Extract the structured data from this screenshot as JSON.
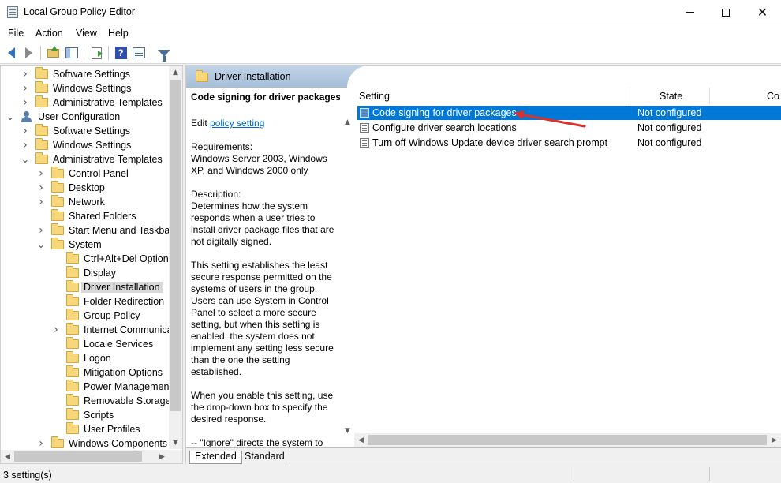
{
  "window": {
    "title": "Local Group Policy Editor",
    "icon": "policy-editor-icon"
  },
  "menu": [
    "File",
    "Action",
    "View",
    "Help"
  ],
  "toolbar": {
    "buttons": [
      "back-icon",
      "forward-icon",
      "up-folder-icon",
      "show-hide-pane-icon",
      "export-list-icon",
      "help-icon",
      "properties-pane-icon",
      "filter-icon"
    ]
  },
  "tree": {
    "items": [
      {
        "label": "Software Settings",
        "depth": 1,
        "expander": "collapsed",
        "icon": "folder-icon"
      },
      {
        "label": "Windows Settings",
        "depth": 1,
        "expander": "collapsed",
        "icon": "folder-icon"
      },
      {
        "label": "Administrative Templates",
        "depth": 1,
        "expander": "collapsed",
        "icon": "folder-icon"
      },
      {
        "label": "User Configuration",
        "depth": 0,
        "expander": "expanded",
        "icon": "user-icon"
      },
      {
        "label": "Software Settings",
        "depth": 1,
        "expander": "collapsed",
        "icon": "folder-icon"
      },
      {
        "label": "Windows Settings",
        "depth": 1,
        "expander": "collapsed",
        "icon": "folder-icon"
      },
      {
        "label": "Administrative Templates",
        "depth": 1,
        "expander": "expanded",
        "icon": "folder-icon"
      },
      {
        "label": "Control Panel",
        "depth": 2,
        "expander": "collapsed",
        "icon": "folder-icon"
      },
      {
        "label": "Desktop",
        "depth": 2,
        "expander": "collapsed",
        "icon": "folder-icon"
      },
      {
        "label": "Network",
        "depth": 2,
        "expander": "collapsed",
        "icon": "folder-icon"
      },
      {
        "label": "Shared Folders",
        "depth": 2,
        "expander": "none",
        "icon": "folder-icon"
      },
      {
        "label": "Start Menu and Taskbar",
        "depth": 2,
        "expander": "collapsed",
        "icon": "folder-icon"
      },
      {
        "label": "System",
        "depth": 2,
        "expander": "expanded",
        "icon": "folder-icon"
      },
      {
        "label": "Ctrl+Alt+Del Options",
        "depth": 3,
        "expander": "none",
        "icon": "folder-icon"
      },
      {
        "label": "Display",
        "depth": 3,
        "expander": "none",
        "icon": "folder-icon"
      },
      {
        "label": "Driver Installation",
        "depth": 3,
        "expander": "none",
        "icon": "folder-icon",
        "selected": true
      },
      {
        "label": "Folder Redirection",
        "depth": 3,
        "expander": "none",
        "icon": "folder-icon"
      },
      {
        "label": "Group Policy",
        "depth": 3,
        "expander": "none",
        "icon": "folder-icon"
      },
      {
        "label": "Internet Communica",
        "depth": 3,
        "expander": "collapsed",
        "icon": "folder-icon"
      },
      {
        "label": "Locale Services",
        "depth": 3,
        "expander": "none",
        "icon": "folder-icon"
      },
      {
        "label": "Logon",
        "depth": 3,
        "expander": "none",
        "icon": "folder-icon"
      },
      {
        "label": "Mitigation Options",
        "depth": 3,
        "expander": "none",
        "icon": "folder-icon"
      },
      {
        "label": "Power Management",
        "depth": 3,
        "expander": "none",
        "icon": "folder-icon"
      },
      {
        "label": "Removable Storage A",
        "depth": 3,
        "expander": "none",
        "icon": "folder-icon"
      },
      {
        "label": "Scripts",
        "depth": 3,
        "expander": "none",
        "icon": "folder-icon"
      },
      {
        "label": "User Profiles",
        "depth": 3,
        "expander": "none",
        "icon": "folder-icon"
      },
      {
        "label": "Windows Components",
        "depth": 2,
        "expander": "collapsed",
        "icon": "folder-icon"
      }
    ]
  },
  "header": {
    "title": "Driver Installation",
    "icon": "folder-icon"
  },
  "description": {
    "title": "Code signing for driver packages",
    "edit_prefix": "Edit",
    "edit_link": "policy setting",
    "requirements_label": "Requirements:",
    "requirements": "Windows Server 2003, Windows XP, and Windows 2000 only",
    "description_label": "Description:",
    "p1": "Determines how the system responds when a user tries to install driver package files that are not digitally signed.",
    "p2": "This setting establishes the least secure response permitted on the systems of users in the group. Users can use System in Control Panel to select a more secure setting, but when this setting is enabled, the system does not implement any setting less secure than the one the setting established.",
    "p3": "When you enable this setting, use the drop-down box to specify the desired response.",
    "p4": "--   \"Ignore\" directs the system to"
  },
  "list": {
    "columns": [
      "Setting",
      "State",
      "Co"
    ],
    "rows": [
      {
        "setting": "Code signing for driver packages",
        "state": "Not configured",
        "selected": true
      },
      {
        "setting": "Configure driver search locations",
        "state": "Not configured"
      },
      {
        "setting": "Turn off Windows Update device driver search prompt",
        "state": "Not configured"
      }
    ]
  },
  "tabs": [
    "Extended",
    "Standard"
  ],
  "active_tab": "Extended",
  "status": "3 setting(s)",
  "colors": {
    "selection": "#0078d7",
    "annotation_arrow": "#d9312b",
    "header_band": "#b4c9e0"
  }
}
